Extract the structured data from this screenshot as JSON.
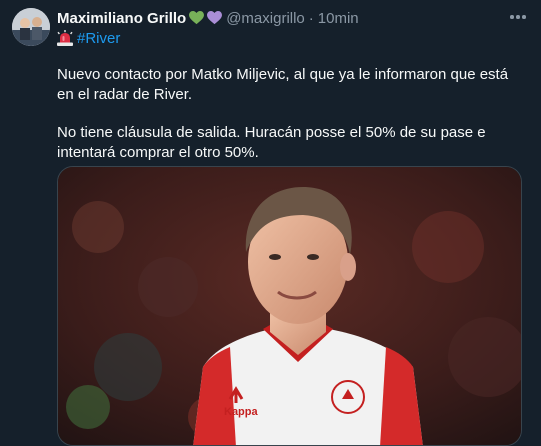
{
  "tweet": {
    "author_name": "Maximiliano Grillo",
    "author_badges": [
      "green-heart-icon",
      "purple-heart-icon"
    ],
    "handle": "@maxigrillo",
    "separator": "·",
    "time": "10min",
    "hashtag": "#River",
    "hashtag_icon": "siren-icon",
    "paragraphs": [
      "Nuevo contacto por Matko Miljevic, al que ya le informaron que está en el radar de River.",
      "No tiene cláusula de salida. Huracán posse el 50% de su pase e intentará comprar el otro 50%."
    ],
    "media": {
      "type": "photo",
      "jersey_brand": "Kappa"
    }
  },
  "colors": {
    "background": "#15202b",
    "text": "#f7f9f9",
    "muted": "#8b98a5",
    "link": "#1d9bf0",
    "green_heart": "#78b159",
    "purple_heart": "#aa8ed6"
  }
}
